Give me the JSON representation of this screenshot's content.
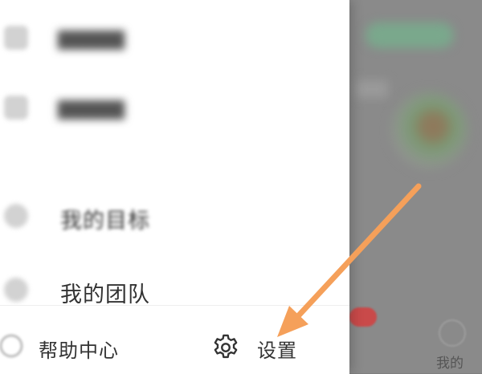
{
  "menu": {
    "items": [
      {
        "icon": "blurred-menu-icon",
        "label": ""
      },
      {
        "icon": "blurred-menu-icon",
        "label": ""
      },
      {
        "icon": "target-icon",
        "label": "我的目标"
      },
      {
        "icon": "team-icon",
        "label": "我的团队"
      }
    ]
  },
  "bottom_bar": {
    "help_label": "帮助中心",
    "help_icon": "help-icon",
    "settings_label": "设置",
    "settings_icon": "gear-icon"
  },
  "background": {
    "tab_label": "我的"
  },
  "annotation": {
    "color": "#f5a05a",
    "icon": "arrow-icon"
  }
}
